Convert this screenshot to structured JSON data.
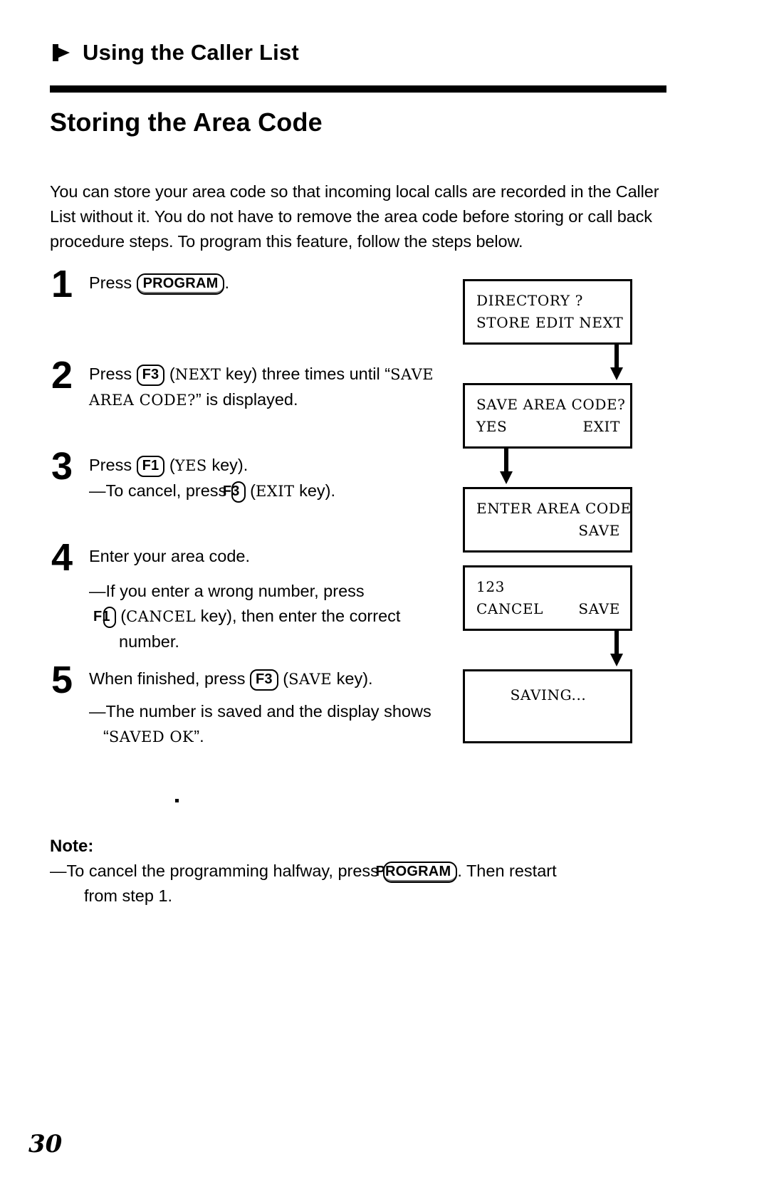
{
  "running_head": {
    "icon": "right-triangle-bullet-icon",
    "title": "Using the Caller List"
  },
  "section": {
    "title": "Storing the Area Code",
    "intro": "You can store your area code so that incoming local calls are recorded in the Caller List without it. You do not have to remove the area code before storing or call back procedure steps. To program this feature, follow the steps below."
  },
  "steps": [
    {
      "number": "1",
      "parts": [
        {
          "type": "text",
          "value": "Press "
        },
        {
          "type": "key",
          "value": "PROGRAM"
        },
        {
          "type": "text",
          "value": "."
        }
      ]
    },
    {
      "number": "2",
      "parts": [
        {
          "type": "text",
          "value": "Press "
        },
        {
          "type": "key",
          "value": "F3"
        },
        {
          "type": "text",
          "value": " ("
        },
        {
          "type": "lcd",
          "value": "NEXT"
        },
        {
          "type": "text",
          "value": " key) three times until “"
        },
        {
          "type": "lcd",
          "value": "SAVE AREA CODE?"
        },
        {
          "type": "text",
          "value": "” is displayed."
        }
      ]
    },
    {
      "number": "3",
      "parts": [
        {
          "type": "text",
          "value": "Press "
        },
        {
          "type": "key",
          "value": "F1"
        },
        {
          "type": "text",
          "value": " ("
        },
        {
          "type": "lcd",
          "value": "YES"
        },
        {
          "type": "text",
          "value": " key)."
        }
      ],
      "sub": [
        {
          "type": "text",
          "value": "—To cancel, press "
        },
        {
          "type": "key",
          "value": "F3"
        },
        {
          "type": "text",
          "value": " ("
        },
        {
          "type": "lcd",
          "value": "EXIT"
        },
        {
          "type": "text",
          "value": " key)."
        }
      ]
    },
    {
      "number": "4",
      "parts": [
        {
          "type": "text",
          "value": "Enter your area code."
        }
      ],
      "sub": [
        {
          "type": "text",
          "value": "—If you enter a wrong number, press"
        }
      ],
      "sub2": [
        {
          "type": "key",
          "value": "F1"
        },
        {
          "type": "text",
          "value": " ("
        },
        {
          "type": "lcd",
          "value": "CANCEL"
        },
        {
          "type": "text",
          "value": " key), then enter the correct number."
        }
      ]
    },
    {
      "number": "5",
      "parts": [
        {
          "type": "text",
          "value": "When finished, press "
        },
        {
          "type": "key",
          "value": "F3"
        },
        {
          "type": "text",
          "value": " ("
        },
        {
          "type": "lcd",
          "value": "SAVE"
        },
        {
          "type": "text",
          "value": " key)."
        }
      ],
      "sub": [
        {
          "type": "text",
          "value": "—The number is saved and the display shows “"
        },
        {
          "type": "lcd",
          "value": "SAVED OK"
        },
        {
          "type": "text",
          "value": "”."
        }
      ]
    }
  ],
  "flow": {
    "screens": [
      {
        "id": "directory",
        "line1_left": "DIRECTORY ?",
        "line1_right": "",
        "line2_left": "STORE EDIT NEXT",
        "line2_right": ""
      },
      {
        "id": "save-area-code",
        "line1_left": "SAVE AREA CODE?",
        "line1_right": "",
        "line2_left": "YES",
        "line2_right": "EXIT"
      },
      {
        "id": "enter-area-code",
        "line1_left": "ENTER AREA CODE",
        "line1_right": "",
        "line2_left": "",
        "line2_right": "SAVE"
      },
      {
        "id": "area-code-entry",
        "line1_left": "123",
        "line1_right": "",
        "line2_left": "CANCEL",
        "line2_right": "SAVE"
      },
      {
        "id": "saving",
        "line1_left": "",
        "line1_center": "SAVING...",
        "line2_left": "",
        "line2_right": ""
      }
    ],
    "connectors": [
      {
        "from": "directory",
        "to": "save-area-code",
        "icon": "arrow-down-icon",
        "align": "right"
      },
      {
        "from": "save-area-code",
        "to": "enter-area-code",
        "icon": "arrow-down-icon",
        "align": "left"
      },
      {
        "from": "enter-area-code",
        "to": "area-code-entry",
        "icon": "none",
        "align": "none"
      },
      {
        "from": "area-code-entry",
        "to": "saving",
        "icon": "arrow-down-icon",
        "align": "right"
      }
    ]
  },
  "note": {
    "title": "Note:",
    "line_a": "—To cancel the programming halfway, press ",
    "key": "PROGRAM",
    "line_b": ". Then restart",
    "line_c": "from step 1."
  },
  "folio": {
    "page_number": "30"
  }
}
